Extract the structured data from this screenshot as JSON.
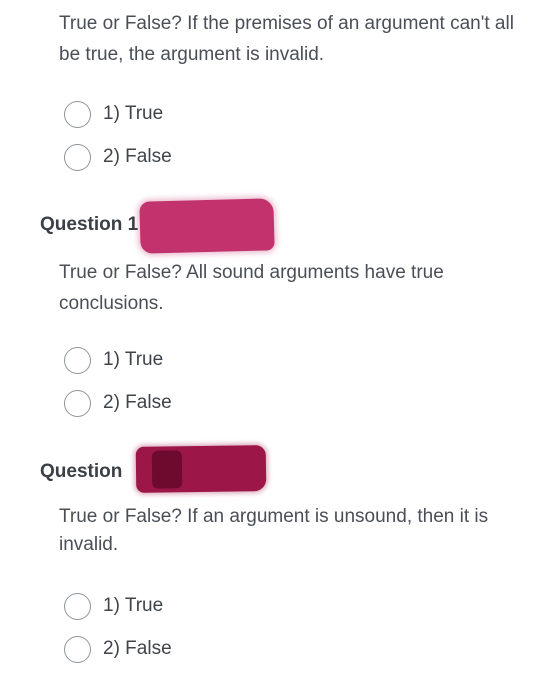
{
  "questions": [
    {
      "text": "True or False? If the premises of an argument can't all be true, the argument is invalid.",
      "options": [
        "1) True",
        "2) False"
      ]
    },
    {
      "heading": "Question 1",
      "text": "True or False? All sound arguments have true conclusions.",
      "options": [
        "1) True",
        "2) False"
      ]
    },
    {
      "heading": "Question",
      "text": "True or False? If an argument is unsound, then it is invalid.",
      "options": [
        "1) True",
        "2) False"
      ]
    }
  ],
  "colors": {
    "redaction_1": "#c2336d",
    "redaction_2": "#9c1748"
  }
}
